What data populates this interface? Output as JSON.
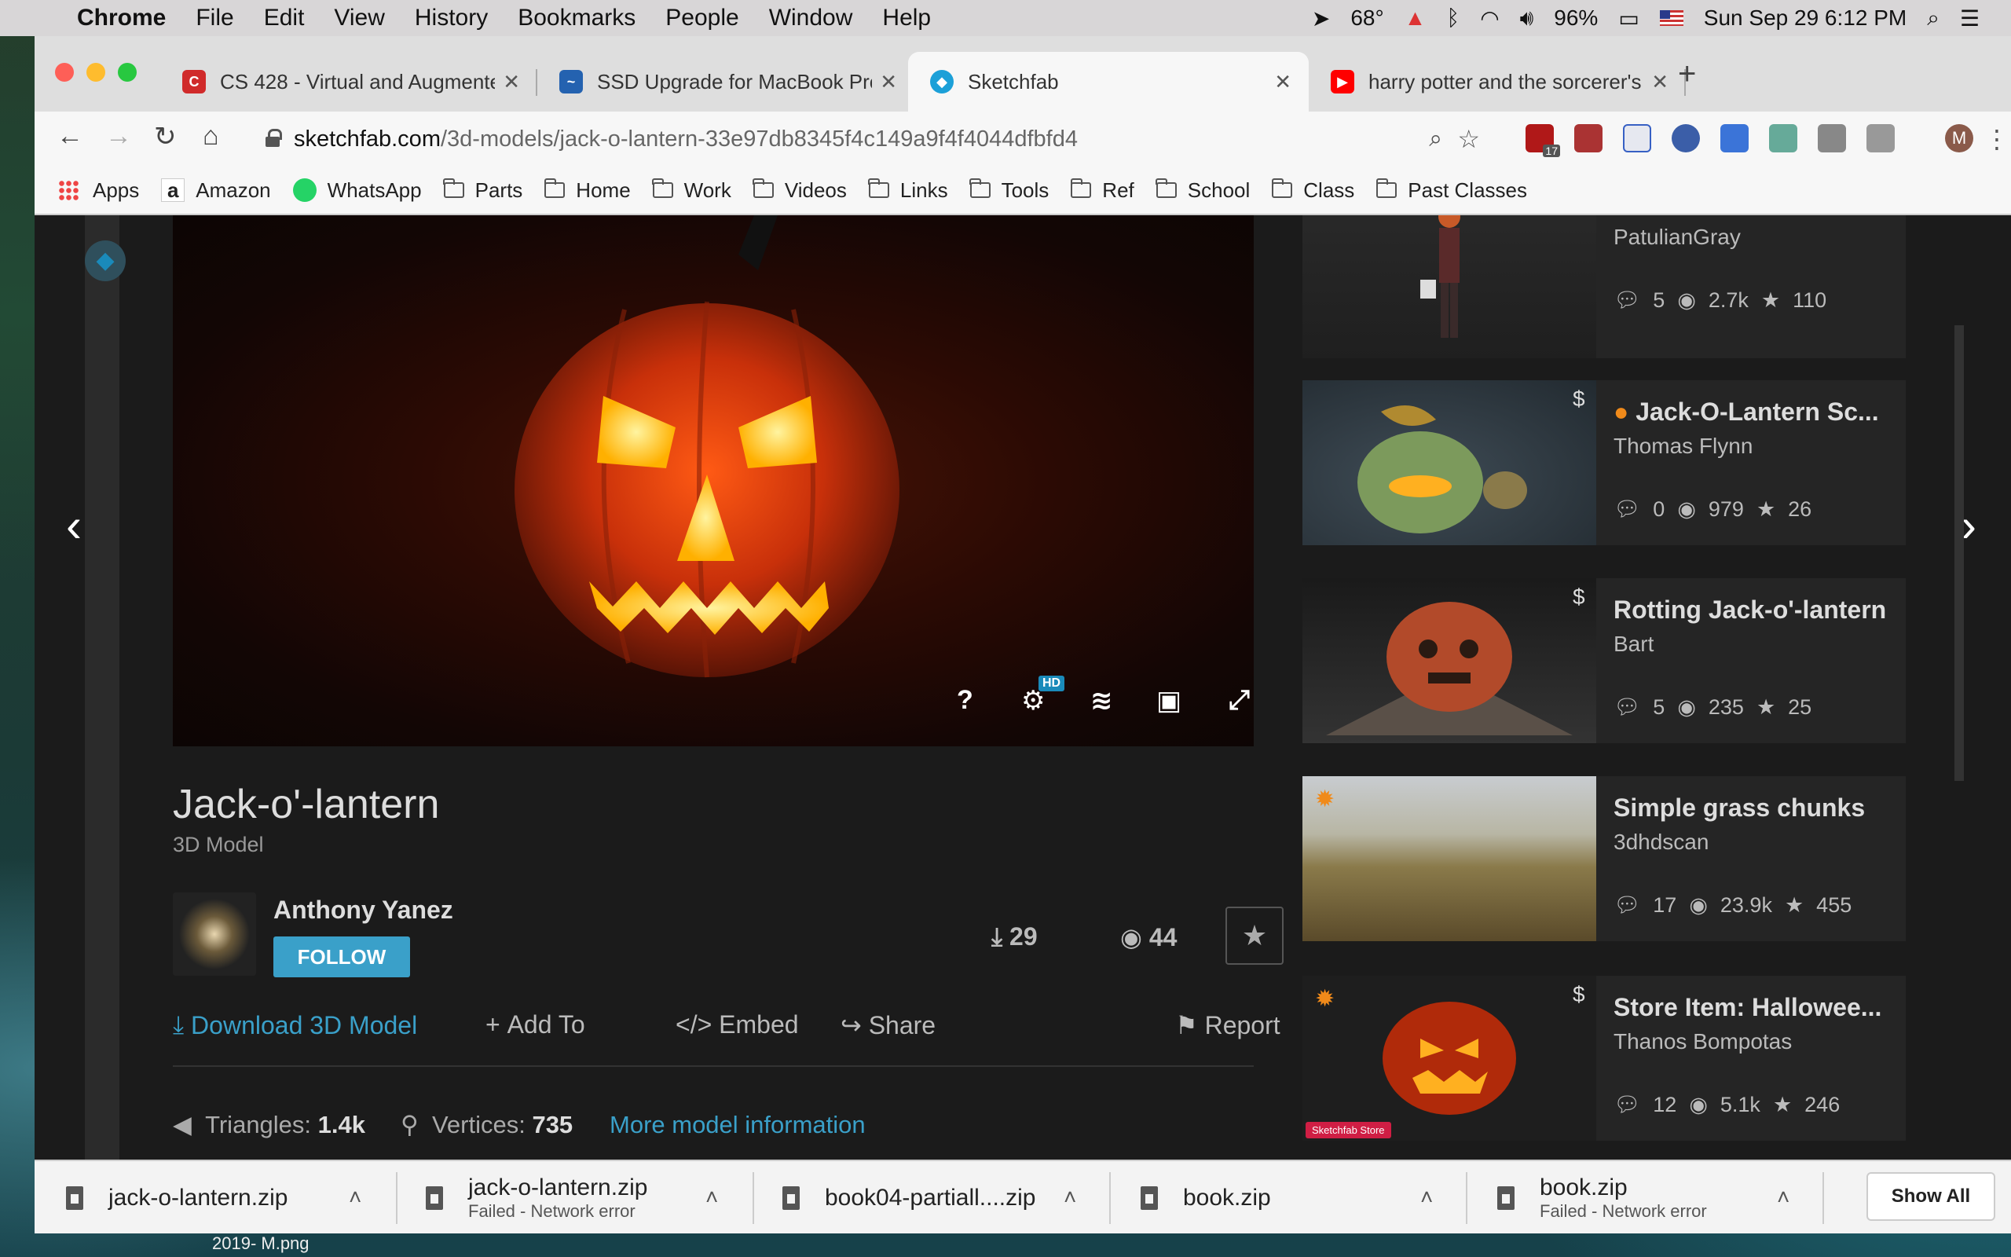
{
  "menubar": {
    "app": "Chrome",
    "items": [
      "File",
      "Edit",
      "View",
      "History",
      "Bookmarks",
      "People",
      "Window",
      "Help"
    ],
    "temp": "68°",
    "battery": "96%",
    "datetime": "Sun Sep 29  6:12 PM"
  },
  "tabs": [
    {
      "title": "CS 428 - Virtual and Augmente",
      "color": "#d02a2a",
      "icon": "C"
    },
    {
      "title": "SSD Upgrade for MacBook Pro",
      "color": "#2462b0",
      "icon": "~"
    },
    {
      "title": "Sketchfab",
      "color": "#1ca0d8",
      "icon": "◆"
    },
    {
      "title": "harry potter and the sorcerer's",
      "color": "#ff0000",
      "icon": "▶"
    }
  ],
  "url": {
    "host": "sketchfab.com",
    "path": "/3d-models/jack-o-lantern-33e97db8345f4c149a9f4f4044dfbfd4"
  },
  "extension_badge": "17",
  "profile": "M",
  "bookmarks": [
    "Apps",
    "Amazon",
    "WhatsApp",
    "Parts",
    "Home",
    "Work",
    "Videos",
    "Links",
    "Tools",
    "Ref",
    "School",
    "Class",
    "Past Classes"
  ],
  "model": {
    "title": "Jack-o'-lantern",
    "subtitle": "3D Model",
    "author": "Anthony Yanez",
    "follow": "FOLLOW",
    "downloads": "29",
    "views": "44",
    "viewer_hd": "HD",
    "actions": {
      "download": "Download 3D Model",
      "add": "Add To",
      "embed": "Embed",
      "share": "Share",
      "report": "Report"
    },
    "triangles_label": "Triangles:",
    "triangles": "1.4k",
    "vertices_label": "Vertices:",
    "vertices": "735",
    "more": "More model information"
  },
  "related": [
    {
      "title": "",
      "author": "PatulianGray",
      "comments": "5",
      "views": "2.7k",
      "likes": "110"
    },
    {
      "title": "Jack-O-Lantern Sc...",
      "author": "Thomas Flynn",
      "comments": "0",
      "views": "979",
      "likes": "26",
      "price": "$"
    },
    {
      "title": "Rotting Jack-o'-lantern",
      "author": "Bart",
      "comments": "5",
      "views": "235",
      "likes": "25",
      "price": "$"
    },
    {
      "title": "Simple grass chunks",
      "author": "3dhdscan",
      "comments": "17",
      "views": "23.9k",
      "likes": "455"
    },
    {
      "title": "Store Item: Hallowee...",
      "author": "Thanos Bompotas",
      "comments": "12",
      "views": "5.1k",
      "likes": "246",
      "price": "$",
      "badge": "Sketchfab Store"
    }
  ],
  "downloads": [
    {
      "name": "jack-o-lantern.zip",
      "status": ""
    },
    {
      "name": "jack-o-lantern.zip",
      "status": "Failed - Network error"
    },
    {
      "name": "book04-partiall....zip",
      "status": ""
    },
    {
      "name": "book.zip",
      "status": ""
    },
    {
      "name": "book.zip",
      "status": "Failed - Network error"
    }
  ],
  "show_all": "Show All",
  "desktop_label": "2019-   M.png"
}
